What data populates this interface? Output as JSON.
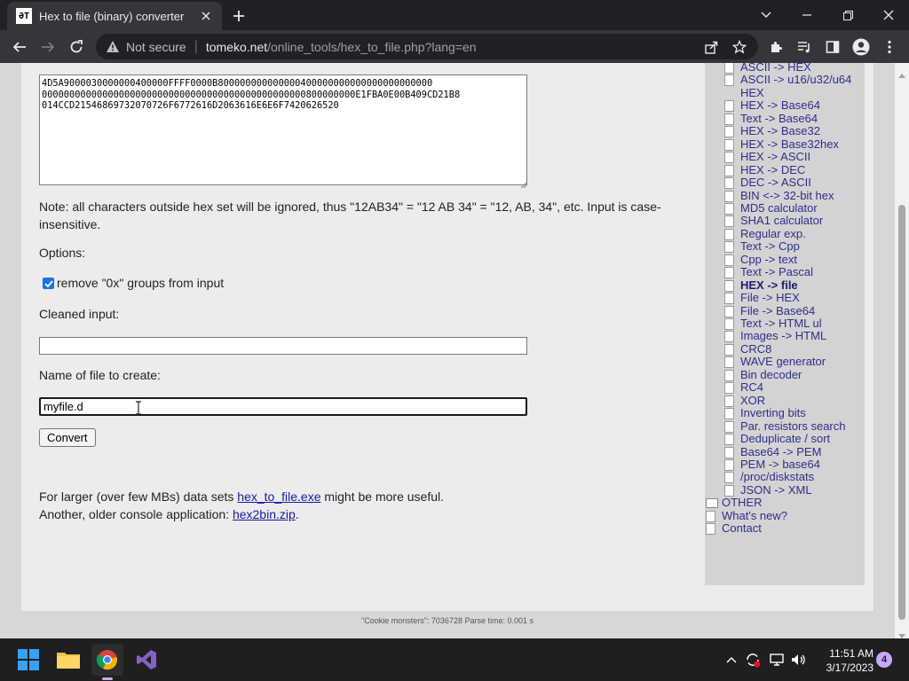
{
  "browser": {
    "tab_title": "Hex to file (binary) converter",
    "not_secure": "Not secure",
    "url_host": "tomeko.net",
    "url_path": "/online_tools/hex_to_file.php?lang=en"
  },
  "page": {
    "hex_input": "4D5A9000030000000400000FFFF0000B800000000000000400000000000000000000000\n000000000000000000000000000000000000000000000000800000000E1FBA0E00B409CD21B8\n014CCD21546869732070726F6772616D2063616E6E6F7420626520",
    "note": "Note: all characters outside hex set will be ignored, thus \"12AB34\" = \"12 AB 34\" = \"12, AB, 34\", etc. Input is case-insensitive.",
    "options_label": "Options:",
    "remove0x_label": "remove \"0x\" groups from input",
    "remove0x_checked": true,
    "cleaned_label": "Cleaned input:",
    "cleaned_value": "",
    "filename_label": "Name of file to create:",
    "filename_value": "myfile.d",
    "convert_label": "Convert",
    "larger_prefix": "For larger (over few MBs) data sets ",
    "larger_link": "hex_to_file.exe",
    "larger_suffix": " might be more useful.",
    "older_prefix": "Another, older console application: ",
    "older_link": "hex2bin.zip",
    "older_suffix": "."
  },
  "sidebar": {
    "items": [
      {
        "label": "ASCII -> HEX",
        "icon": "document-icon"
      },
      {
        "label": "ASCII -> u16/u32/u64",
        "icon": "document-icon"
      },
      {
        "label": "HEX",
        "icon": ""
      },
      {
        "label": "HEX -> Base64",
        "icon": "document-icon"
      },
      {
        "label": "Text -> Base64",
        "icon": "document-icon"
      },
      {
        "label": "HEX -> Base32",
        "icon": "document-icon"
      },
      {
        "label": "HEX -> Base32hex",
        "icon": "document-icon"
      },
      {
        "label": "HEX -> ASCII",
        "icon": "document-icon"
      },
      {
        "label": "HEX -> DEC",
        "icon": "document-icon"
      },
      {
        "label": "DEC -> ASCII",
        "icon": "document-icon"
      },
      {
        "label": "BIN <-> 32-bit hex",
        "icon": "document-icon"
      },
      {
        "label": "MD5 calculator",
        "icon": "document-icon"
      },
      {
        "label": "SHA1 calculator",
        "icon": "document-icon"
      },
      {
        "label": "Regular exp.",
        "icon": "document-icon"
      },
      {
        "label": "Text -> Cpp",
        "icon": "document-icon"
      },
      {
        "label": "Cpp -> text",
        "icon": "document-icon"
      },
      {
        "label": "Text -> Pascal",
        "icon": "document-icon"
      },
      {
        "label": "HEX -> file",
        "icon": "document-icon",
        "active": true
      },
      {
        "label": "File -> HEX",
        "icon": "document-icon"
      },
      {
        "label": "File -> Base64",
        "icon": "document-icon"
      },
      {
        "label": "Text -> HTML ul",
        "icon": "document-icon"
      },
      {
        "label": "Images -> HTML",
        "icon": "document-icon"
      },
      {
        "label": "CRC8",
        "icon": "document-icon"
      },
      {
        "label": "WAVE generator",
        "icon": "document-icon"
      },
      {
        "label": "Bin decoder",
        "icon": "document-icon"
      },
      {
        "label": "RC4",
        "icon": "document-icon"
      },
      {
        "label": "XOR",
        "icon": "document-icon"
      },
      {
        "label": "Inverting bits",
        "icon": "document-icon"
      },
      {
        "label": "Par. resistors search",
        "icon": "document-icon"
      },
      {
        "label": "Deduplicate / sort",
        "icon": "document-icon"
      },
      {
        "label": "Base64 -> PEM",
        "icon": "document-icon"
      },
      {
        "label": "PEM -> base64",
        "icon": "document-icon"
      },
      {
        "label": "/proc/diskstats",
        "icon": "document-icon"
      },
      {
        "label": "JSON -> XML",
        "icon": "document-icon"
      }
    ],
    "bottom_items": [
      {
        "label": "OTHER",
        "icon": "folder-icon"
      },
      {
        "label": "What's new?",
        "icon": "document-icon"
      },
      {
        "label": "Contact",
        "icon": "document-icon"
      }
    ]
  },
  "footer": {
    "text": "\"Cookie monsters\": 7036728    Parse time: 0.001 s"
  },
  "taskbar": {
    "time": "11:51 AM",
    "date": "3/17/2023",
    "notification_count": "4"
  }
}
